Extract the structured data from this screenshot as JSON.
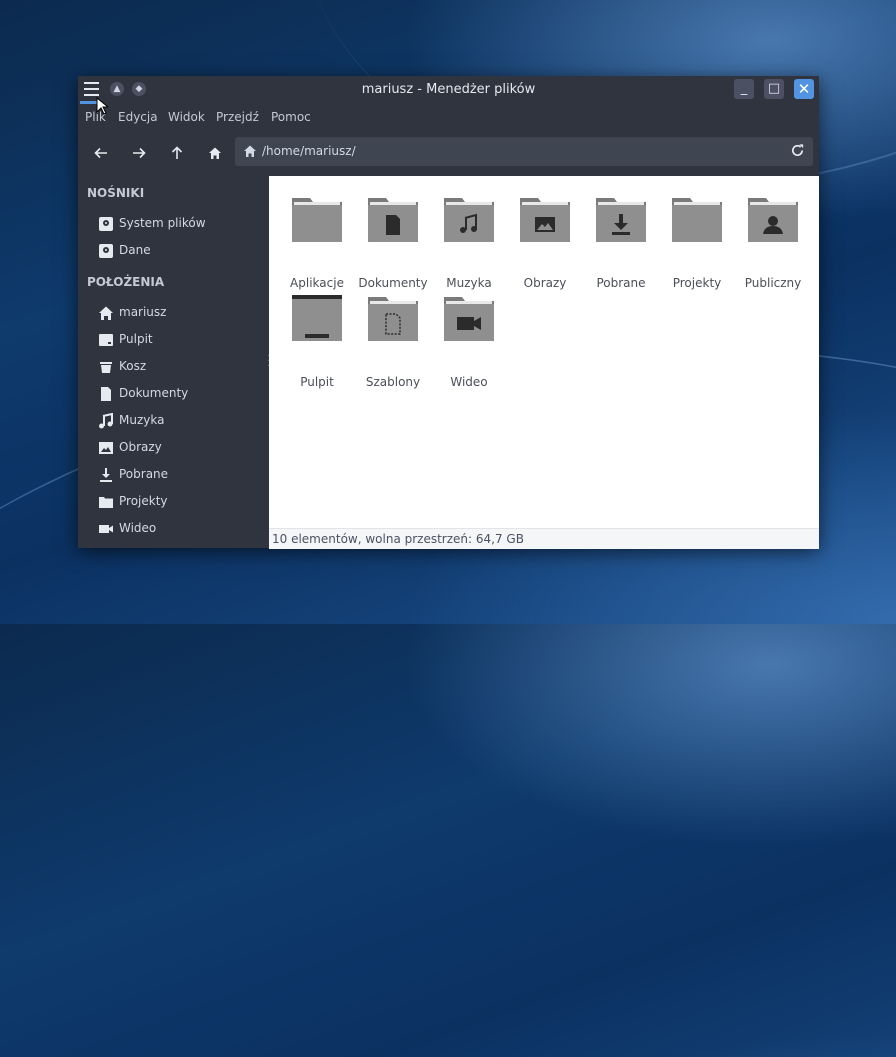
{
  "window": {
    "title": "mariusz - Menedżer plików",
    "buttons": {
      "minimize": "_",
      "maximize": "□",
      "close": "✕"
    }
  },
  "menubar": [
    "Plik",
    "Edycja",
    "Widok",
    "Przejdź",
    "Pomoc"
  ],
  "toolbar": {
    "location_path": "/home/mariusz/",
    "back_icon": "arrow-left-icon",
    "forward_icon": "arrow-right-icon",
    "up_icon": "arrow-up-icon",
    "home_icon": "home-icon",
    "reload_icon": "reload-icon"
  },
  "sidebar": {
    "devices_header": "NOŚNIKI",
    "devices": [
      {
        "label": "System plików",
        "icon": "drive-icon"
      },
      {
        "label": "Dane",
        "icon": "drive-icon"
      }
    ],
    "places_header": "POŁOŻENIA",
    "places": [
      {
        "label": "mariusz",
        "icon": "home-icon"
      },
      {
        "label": "Pulpit",
        "icon": "desktop-icon"
      },
      {
        "label": "Kosz",
        "icon": "trash-icon"
      },
      {
        "label": "Dokumenty",
        "icon": "document-icon"
      },
      {
        "label": "Muzyka",
        "icon": "music-icon"
      },
      {
        "label": "Obrazy",
        "icon": "image-icon"
      },
      {
        "label": "Pobrane",
        "icon": "download-icon"
      },
      {
        "label": "Projekty",
        "icon": "folder-icon"
      },
      {
        "label": "Wideo",
        "icon": "video-icon"
      }
    ]
  },
  "files": [
    {
      "label": "Aplikacje",
      "icon": "folder-icon"
    },
    {
      "label": "Dokumenty",
      "icon": "folder-documents-icon"
    },
    {
      "label": "Muzyka",
      "icon": "folder-music-icon"
    },
    {
      "label": "Obrazy",
      "icon": "folder-pictures-icon"
    },
    {
      "label": "Pobrane",
      "icon": "folder-download-icon"
    },
    {
      "label": "Projekty",
      "icon": "folder-icon"
    },
    {
      "label": "Publiczny",
      "icon": "folder-public-icon"
    },
    {
      "label": "Pulpit",
      "icon": "folder-desktop-icon"
    },
    {
      "label": "Szablony",
      "icon": "folder-templates-icon"
    },
    {
      "label": "Wideo",
      "icon": "folder-video-icon"
    }
  ],
  "status": "10 elementów, wolna przestrzeń: 64,7 GB",
  "colors": {
    "accent": "#5294e2",
    "window_bg": "#2f343f",
    "folder": "#8f8f8f",
    "folder_tab": "#7b7b7b"
  }
}
